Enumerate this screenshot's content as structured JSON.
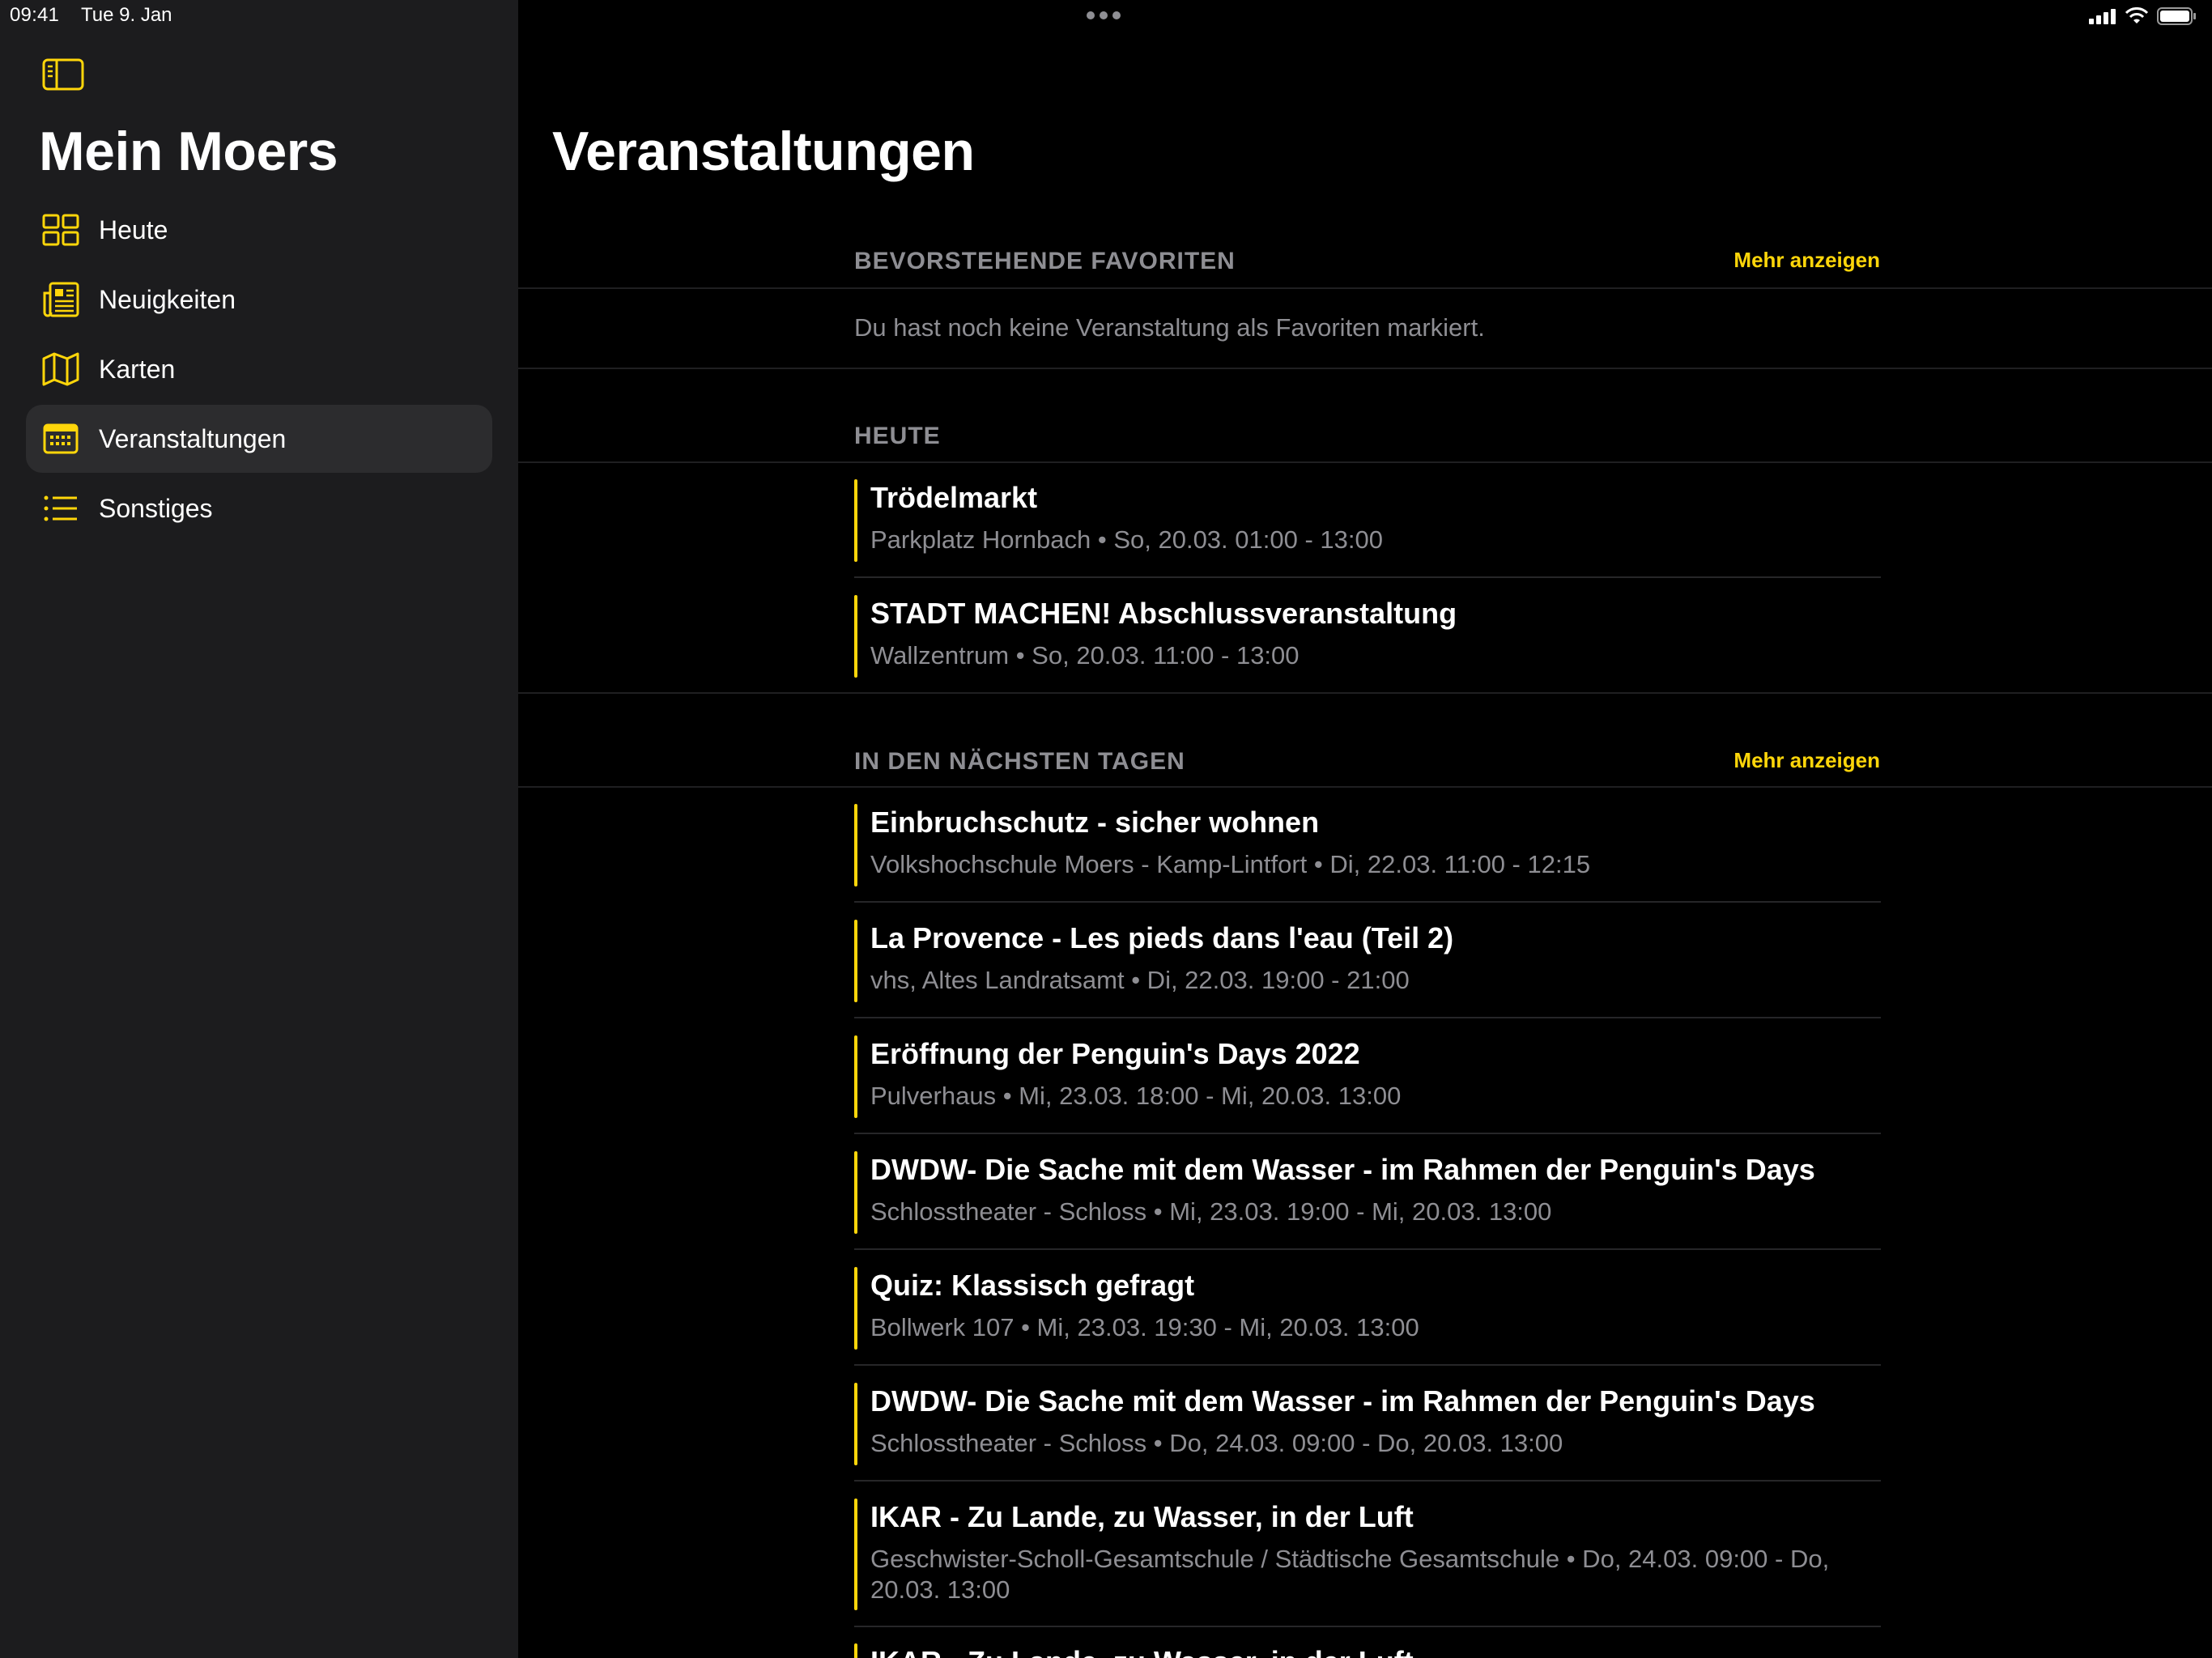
{
  "status_bar": {
    "time": "09:41",
    "date": "Tue 9. Jan"
  },
  "sidebar": {
    "title": "Mein Moers",
    "items": [
      {
        "label": "Heute",
        "icon": "grid-icon"
      },
      {
        "label": "Neuigkeiten",
        "icon": "newspaper-icon"
      },
      {
        "label": "Karten",
        "icon": "map-icon"
      },
      {
        "label": "Veranstaltungen",
        "icon": "calendar-icon",
        "active": true
      },
      {
        "label": "Sonstiges",
        "icon": "list-icon"
      }
    ]
  },
  "colors": {
    "accent": "#ffd60a",
    "sidebar_bg": "#1c1c1e",
    "active_bg": "#2c2c2e",
    "secondary_text": "#8e8e93"
  },
  "main": {
    "title": "Veranstaltungen",
    "favorites": {
      "label": "BEVORSTEHENDE FAVORITEN",
      "more": "Mehr anzeigen",
      "empty": "Du hast noch keine Veranstaltung als Favoriten markiert."
    },
    "today": {
      "label": "HEUTE",
      "events": [
        {
          "title": "Trödelmarkt",
          "subtitle": "Parkplatz Hornbach • So, 20.03. 01:00 - 13:00"
        },
        {
          "title": "STADT MACHEN! Abschlussveranstaltung",
          "subtitle": "Wallzentrum • So, 20.03. 11:00 - 13:00"
        }
      ]
    },
    "upcoming": {
      "label": "IN DEN NÄCHSTEN TAGEN",
      "more": "Mehr anzeigen",
      "events": [
        {
          "title": "Einbruchschutz - sicher wohnen",
          "subtitle": "Volkshochschule Moers - Kamp-Lintfort • Di, 22.03. 11:00 - 12:15"
        },
        {
          "title": "La Provence - Les pieds dans l'eau (Teil 2)",
          "subtitle": "vhs, Altes Landratsamt • Di, 22.03. 19:00 - 21:00"
        },
        {
          "title": "Eröffnung der Penguin's Days 2022",
          "subtitle": "Pulverhaus • Mi, 23.03. 18:00 - Mi, 20.03. 13:00"
        },
        {
          "title": "DWDW- Die Sache mit dem Wasser - im Rahmen der Penguin's Days",
          "subtitle": "Schlosstheater - Schloss • Mi, 23.03. 19:00 - Mi, 20.03. 13:00"
        },
        {
          "title": "Quiz: Klassisch gefragt",
          "subtitle": "Bollwerk 107 • Mi, 23.03. 19:30 - Mi, 20.03. 13:00"
        },
        {
          "title": "DWDW- Die Sache mit dem Wasser - im Rahmen der Penguin's Days",
          "subtitle": "Schlosstheater - Schloss • Do, 24.03. 09:00 - Do, 20.03. 13:00"
        },
        {
          "title": "IKAR - Zu Lande, zu Wasser, in der Luft",
          "subtitle": "Geschwister-Scholl-Gesamtschule / Städtische Gesamtschule • Do, 24.03. 09:00 - Do, 20.03. 13:00"
        },
        {
          "title": "IKAR - Zu Lande, zu Wasser, in der Luft",
          "subtitle": ""
        }
      ]
    }
  }
}
